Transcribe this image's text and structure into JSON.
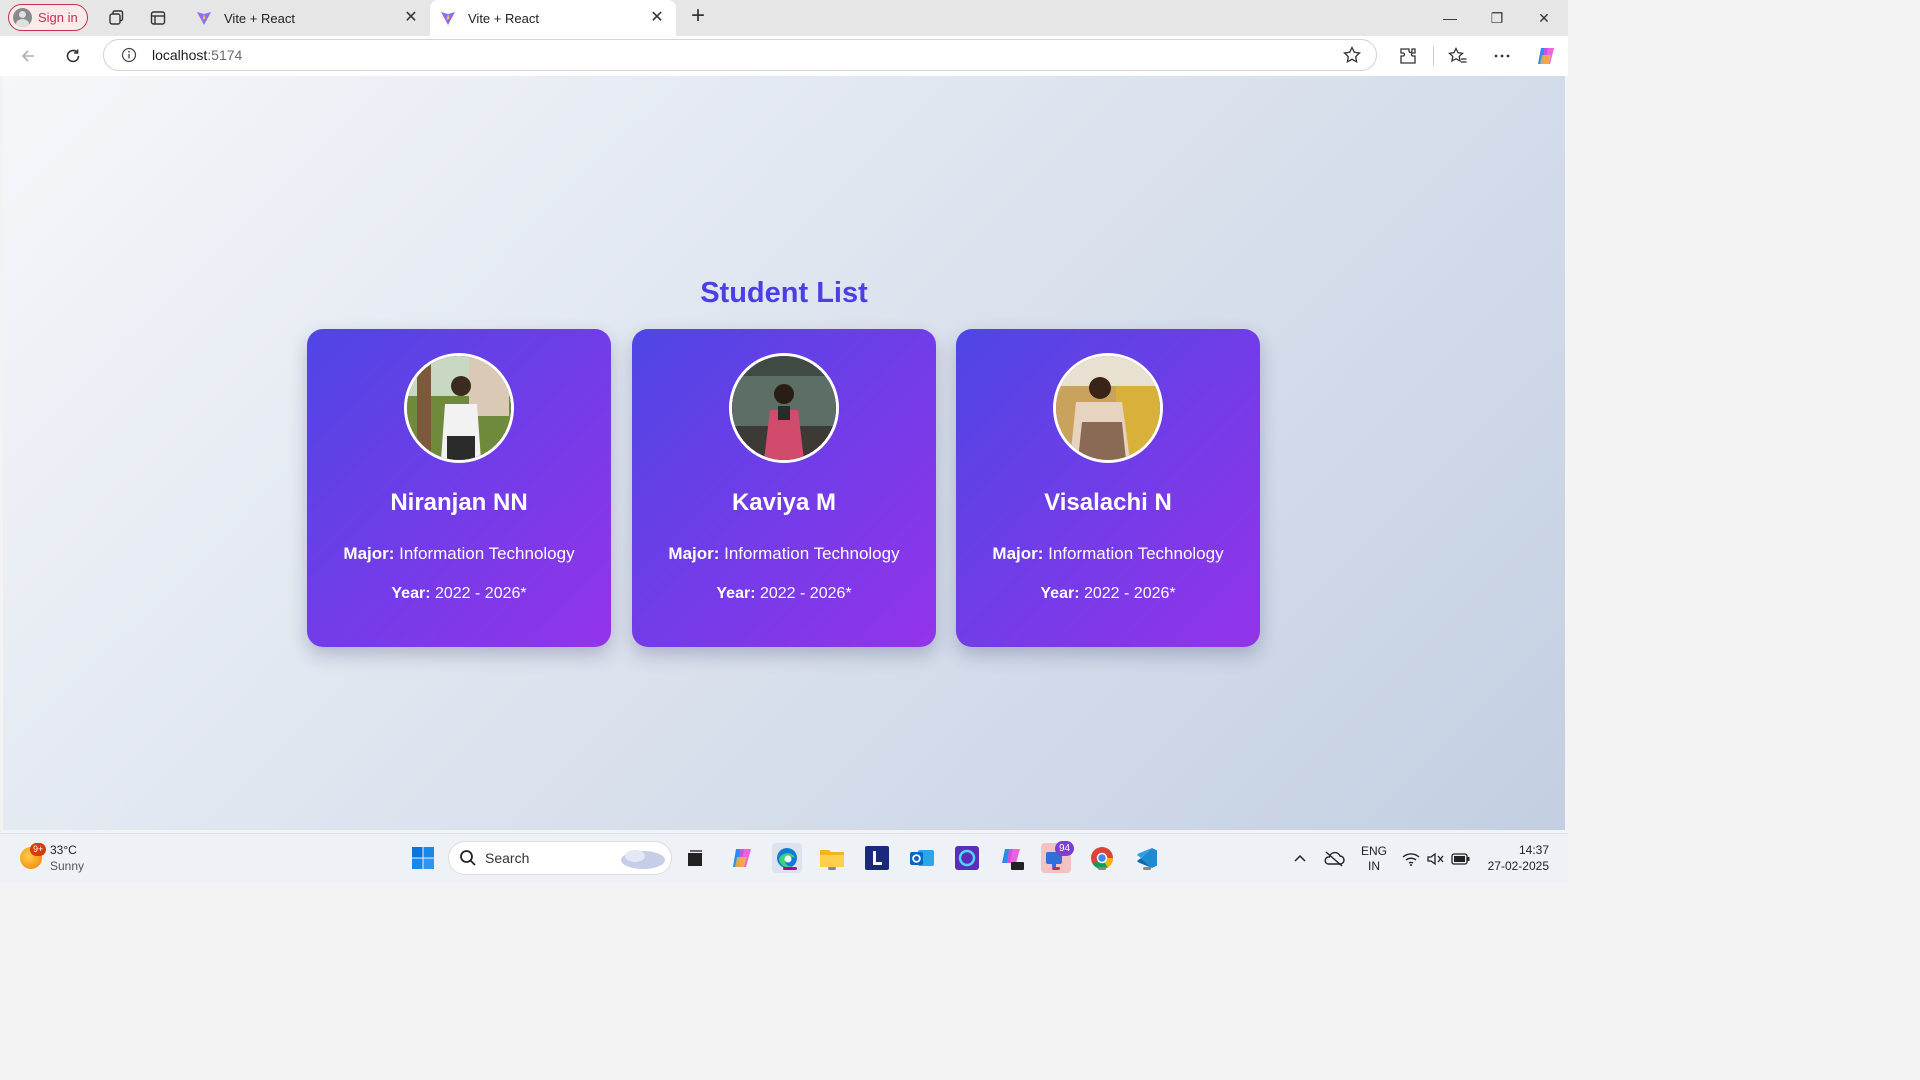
{
  "browser": {
    "signin_label": "Sign in",
    "tabs": [
      {
        "title": "Vite + React",
        "active": false
      },
      {
        "title": "Vite + React",
        "active": true
      }
    ],
    "url_host": "localhost",
    "url_port": ":5174"
  },
  "page": {
    "heading": "Student List",
    "students": [
      {
        "name": "Niranjan NN",
        "major_label": "Major:",
        "major": " Information Technology",
        "year_label": "Year:",
        "year": " 2022 - 2026*"
      },
      {
        "name": "Kaviya M",
        "major_label": "Major:",
        "major": " Information Technology",
        "year_label": "Year:",
        "year": " 2022 - 2026*"
      },
      {
        "name": "Visalachi N",
        "major_label": "Major:",
        "major": " Information Technology",
        "year_label": "Year:",
        "year": " 2022 - 2026*"
      }
    ]
  },
  "taskbar": {
    "weather_badge": "9+",
    "temperature": "33°C",
    "condition": "Sunny",
    "search_label": "Search",
    "teams_badge": "94",
    "lang_line1": "ENG",
    "lang_line2": "IN",
    "time": "14:37",
    "date": "27-02-2025"
  },
  "colors": {
    "heading": "#4a3ee6",
    "card_gradient_start": "#4f46e5",
    "card_gradient_end": "#9333ea",
    "signin_red": "#c4314b"
  }
}
